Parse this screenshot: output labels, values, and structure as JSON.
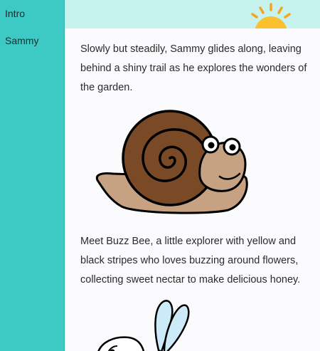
{
  "sidebar": {
    "items": [
      {
        "label": "Intro"
      },
      {
        "label": "Sammy"
      }
    ]
  },
  "main": {
    "paragraphs": [
      {
        "text": "Slowly but steadily, Sammy glides along, leaving behind a shiny trail as he explores the wonders of the garden."
      },
      {
        "text": "Meet Buzz Bee, a little explorer with yellow and black stripes who loves buzzing around flowers, collecting sweet nectar to make delicious honey."
      }
    ]
  },
  "icons": {
    "sun": "sun-icon",
    "snail": "snail-illustration",
    "bee": "bee-illustration"
  },
  "colors": {
    "sidebar": "#3dcac4",
    "top_strip": "#c6f3ee",
    "content_bg": "#fbfbfe",
    "sun": "#fbc02d",
    "snail_shell": "#7a4a26",
    "snail_body": "#c6a283",
    "bee_wing": "#cdeaf8"
  }
}
